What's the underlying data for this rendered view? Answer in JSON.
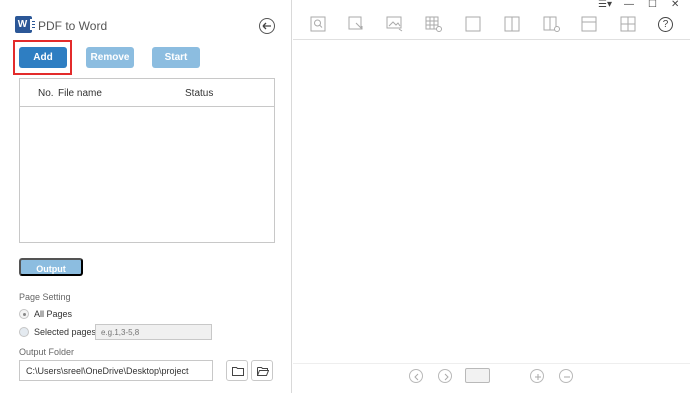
{
  "app": {
    "title": "PDF to Word",
    "logo_letter": "W"
  },
  "actions": {
    "add_label": "Add",
    "remove_label": "Remove",
    "start_label": "Start"
  },
  "file_table": {
    "columns": [
      "No.",
      "File name",
      "Status"
    ],
    "rows": []
  },
  "output_setting_label": "Output Setting",
  "page_setting": {
    "label": "Page Setting",
    "options": [
      {
        "label": "All Pages",
        "checked": true
      },
      {
        "label": "Selected pages",
        "checked": false
      }
    ],
    "pages_placeholder": "e.g.1,3-5,8"
  },
  "output_folder": {
    "label": "Output Folder",
    "path": "C:\\Users\\sreel\\OneDrive\\Desktop\\project"
  },
  "window_controls": {
    "menu": "☰▾",
    "minimize": "—",
    "maximize": "☐",
    "close": "✕"
  },
  "toolbar": {
    "icons": [
      "zoom-icon",
      "select-icon",
      "image-icon",
      "table-icon",
      "region-icon",
      "split-vertical-icon",
      "page-add-icon",
      "layout-horizontal-icon",
      "grid-icon"
    ],
    "help": "?"
  },
  "colors": {
    "primary": "#2e7ec2",
    "primary_light": "#8cbde0",
    "highlight": "#e32b2b",
    "logo": "#2b5797"
  }
}
